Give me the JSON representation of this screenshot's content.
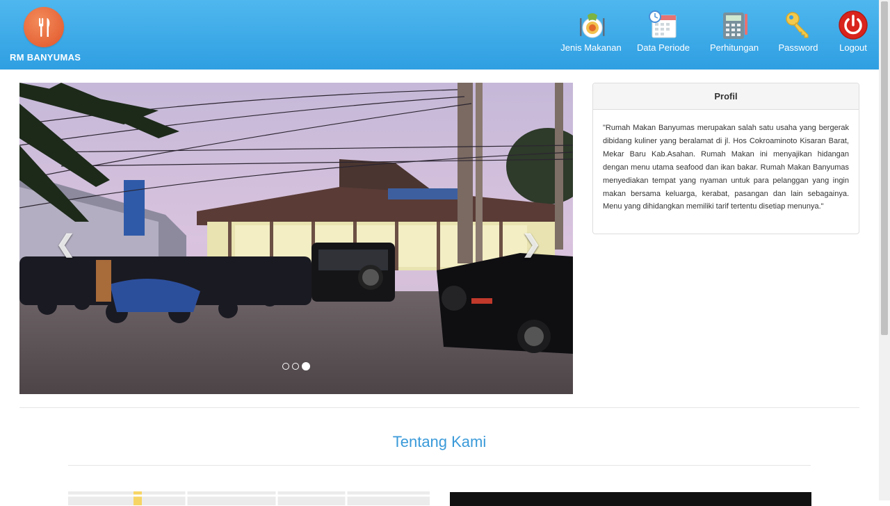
{
  "brand": {
    "name": "RM BANYUMAS",
    "logo_icon": "fork-knife-icon",
    "logo_color": "#e8633a"
  },
  "header": {
    "color_top": "#4fb7ee",
    "color_bottom": "#2f9fe2"
  },
  "nav": [
    {
      "label": "Jenis Makanan",
      "icon": "food-plate-icon"
    },
    {
      "label": "Data Periode",
      "icon": "calendar-icon"
    },
    {
      "label": "Perhitungan",
      "icon": "calculator-icon"
    },
    {
      "label": "Password",
      "icon": "key-icon"
    },
    {
      "label": "Logout",
      "icon": "power-icon"
    }
  ],
  "carousel": {
    "prev_icon": "chevron-left-icon",
    "next_icon": "chevron-right-icon",
    "prev_glyph": "❮",
    "next_glyph": "❯",
    "slide_count": 3,
    "active_slide": 3
  },
  "profile": {
    "title": "Profil",
    "text": "\"Rumah Makan Banyumas merupakan salah satu usaha yang bergerak dibidang kuliner yang beralamat di jl. Hos Cokroaminoto Kisaran Barat, Mekar Baru Kab.Asahan. Rumah Makan ini menyajikan hidangan dengan menu utama seafood dan ikan bakar. Rumah Makan Banyumas menyediakan tempat yang nyaman untuk para pelanggan yang ingin makan bersama keluarga, kerabat, pasangan dan lain sebagainya. Menu yang dihidangkan memiliki tarif tertentu disetiap menunya.\""
  },
  "about": {
    "title": "Tentang Kami"
  },
  "colors": {
    "accent": "#3a9ad9",
    "logout_red": "#d9231d"
  }
}
